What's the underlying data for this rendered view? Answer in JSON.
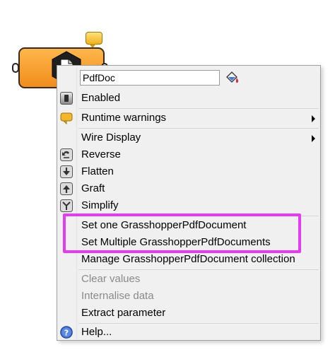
{
  "component": {
    "icon": "pdf-document-icon",
    "balloon_icon": "runtime-warning-balloon-icon"
  },
  "menu": {
    "name_value": "PdfDoc",
    "paint_icon": "paint-bucket-icon",
    "items": [
      {
        "label": "Enabled",
        "icon": "enabled-toggle-icon",
        "enabled": true
      },
      {
        "label": "Runtime warnings",
        "icon": "warning-balloon-icon",
        "submenu": true,
        "enabled": true
      },
      {
        "label": "Wire Display",
        "submenu": true,
        "enabled": true
      },
      {
        "label": "Reverse",
        "icon": "reverse-icon",
        "enabled": true
      },
      {
        "label": "Flatten",
        "icon": "flatten-icon",
        "enabled": true
      },
      {
        "label": "Graft",
        "icon": "graft-icon",
        "enabled": true
      },
      {
        "label": "Simplify",
        "icon": "simplify-icon",
        "enabled": true
      },
      {
        "label": "Set one GrasshopperPdfDocument",
        "enabled": true
      },
      {
        "label": "Set Multiple GrasshopperPdfDocuments",
        "enabled": true
      },
      {
        "label": "Manage GrasshopperPdfDocument collection",
        "enabled": true
      },
      {
        "label": "Clear values",
        "enabled": false
      },
      {
        "label": "Internalise data",
        "enabled": false
      },
      {
        "label": "Extract parameter",
        "enabled": true
      },
      {
        "label": "Help...",
        "icon": "help-icon",
        "enabled": true
      }
    ]
  },
  "colors": {
    "highlight": "#e33cf0",
    "component_fill": "#f59a2a"
  }
}
